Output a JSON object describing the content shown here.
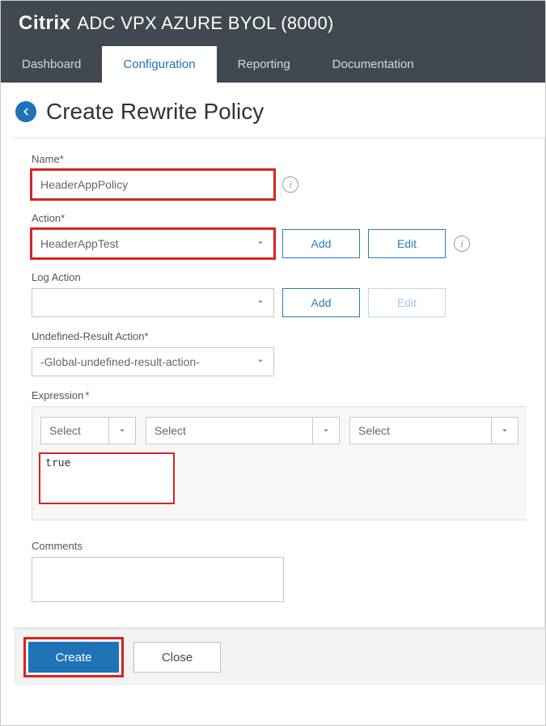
{
  "header": {
    "brand": "Citrix",
    "product": "ADC VPX AZURE BYOL (8000)"
  },
  "tabs": {
    "items": [
      {
        "label": "Dashboard"
      },
      {
        "label": "Configuration"
      },
      {
        "label": "Reporting"
      },
      {
        "label": "Documentation"
      }
    ],
    "active_index": 1
  },
  "page": {
    "title": "Create Rewrite Policy"
  },
  "form": {
    "name": {
      "label": "Name",
      "value": "HeaderAppPolicy"
    },
    "action": {
      "label": "Action",
      "selected": "HeaderAppTest",
      "add_label": "Add",
      "edit_label": "Edit"
    },
    "log_action": {
      "label": "Log Action",
      "selected": "",
      "add_label": "Add",
      "edit_label": "Edit"
    },
    "undefined_result": {
      "label": "Undefined-Result Action",
      "selected": "-Global-undefined-result-action-"
    },
    "expression": {
      "label": "Expression",
      "select_placeholder": "Select",
      "value": "true"
    },
    "comments": {
      "label": "Comments",
      "value": ""
    }
  },
  "footer": {
    "create_label": "Create",
    "close_label": "Close"
  }
}
